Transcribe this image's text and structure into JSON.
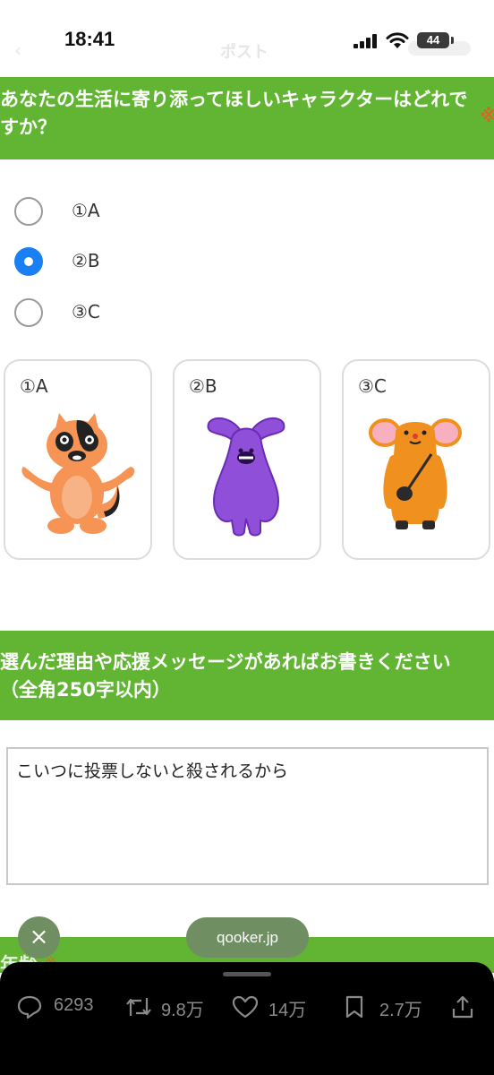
{
  "status_bar": {
    "time": "18:41",
    "battery": "44",
    "ghost_title": "ポスト"
  },
  "question1": {
    "text": "あなたの生活に寄り添ってほしいキャラクターはどれですか？",
    "required_mark": "※",
    "options": [
      {
        "label": "①A",
        "selected": false
      },
      {
        "label": "②B",
        "selected": true
      },
      {
        "label": "③C",
        "selected": false
      }
    ],
    "cards": [
      {
        "label": "①A",
        "character": "orange-fox-character"
      },
      {
        "label": "②B",
        "character": "purple-rabbit-character"
      },
      {
        "label": "③C",
        "character": "orange-monkey-character"
      }
    ]
  },
  "question2": {
    "text": "選んだ理由や応援メッセージがあればお書きください（全角250字以内）",
    "answer": "こいつに投票しないと殺されるから"
  },
  "question3": {
    "text": "年齢",
    "required_mark": "※"
  },
  "overlay": {
    "close_symbol": "×",
    "url": "qooker.jp"
  },
  "actions": [
    {
      "icon": "reply-icon",
      "count": "6293"
    },
    {
      "icon": "retweet-icon",
      "count": "9.8万"
    },
    {
      "icon": "like-icon",
      "count": "14万"
    },
    {
      "icon": "bookmark-icon",
      "count": "2.7万"
    },
    {
      "icon": "share-icon",
      "count": ""
    }
  ],
  "colors": {
    "header_green": "#62b532",
    "radio_selected": "#1a7ff2"
  }
}
